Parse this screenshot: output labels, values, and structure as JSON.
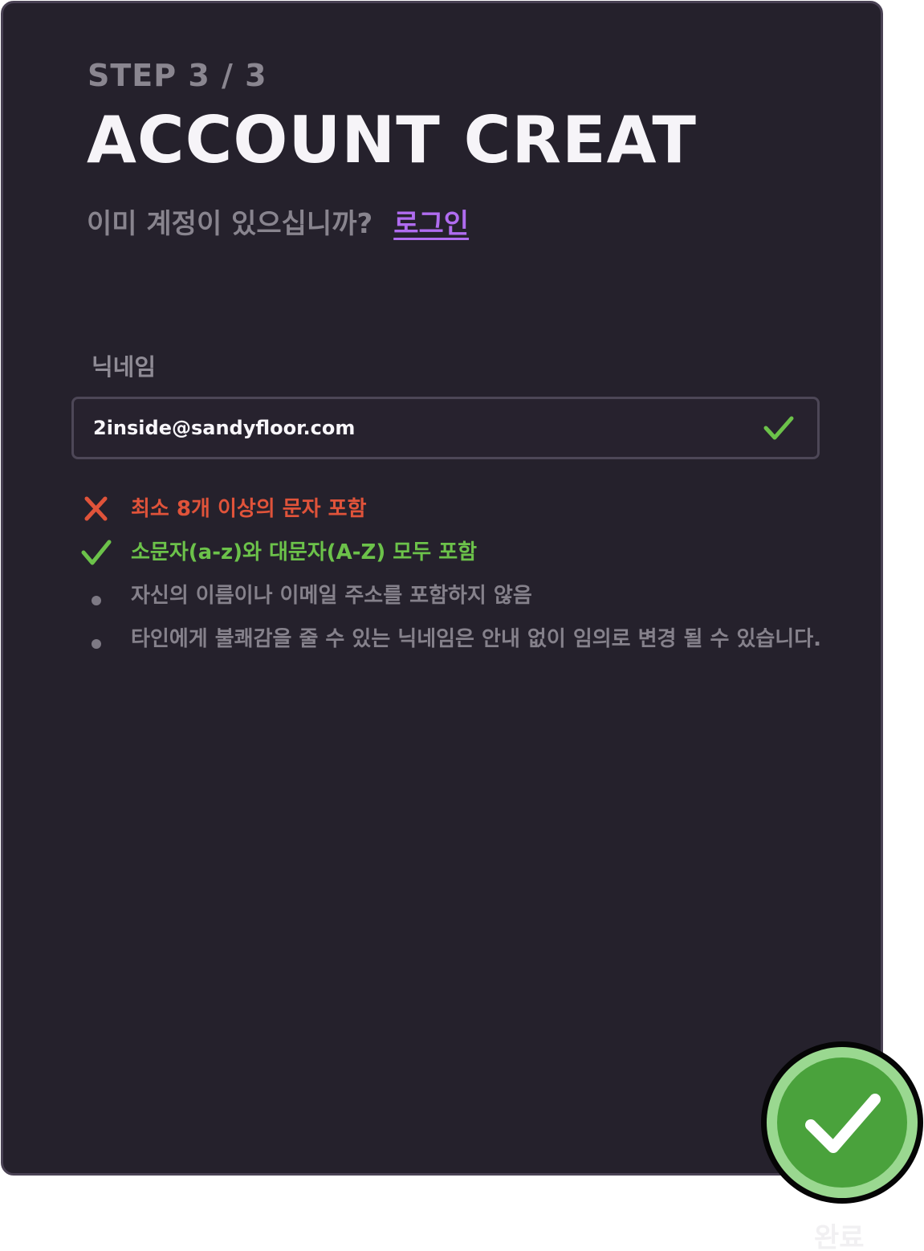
{
  "header": {
    "step": "STEP 3 / 3",
    "title": "ACCOUNT CREAT",
    "login_question": "이미 계정이 있으십니까?",
    "login_link": "로그인"
  },
  "form": {
    "nickname_label": "닉네임",
    "nickname_value": "2inside@sandyfloor.com",
    "nickname_valid": true
  },
  "rules": [
    {
      "status": "fail",
      "text": "최소 8개 이상의 문자 포함"
    },
    {
      "status": "pass",
      "text": "소문자(a-z)와 대문자(A-Z) 모두 포함"
    },
    {
      "status": "info",
      "text": "자신의 이름이나 이메일 주소를 포함하지 않음"
    },
    {
      "status": "info",
      "text": "타인에게 불쾌감을 줄 수 있는 닉네임은 안내 없이 임의로 변경 될 수 있습니다."
    }
  ],
  "actions": {
    "done_label": "완료"
  },
  "colors": {
    "card_bg": "#25212c",
    "card_border": "#4a4254",
    "link": "#b06cf0",
    "fail": "#e0533a",
    "pass": "#6cc24a",
    "info": "#85818b",
    "done_core": "#4aa23c",
    "done_ring": "#9ad890"
  },
  "icons": {
    "input_status": "check-icon",
    "fail": "close-icon",
    "pass": "check-icon",
    "info": "bullet-dot",
    "done": "check-icon"
  }
}
